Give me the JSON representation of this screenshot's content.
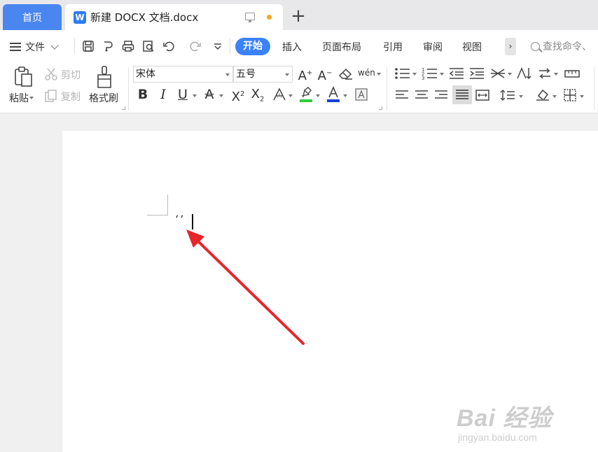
{
  "tabs": {
    "home": "首页",
    "doc_icon": "W",
    "doc_title": "新建 DOCX 文档.docx",
    "new_tab": "+"
  },
  "menu": {
    "file": "文件",
    "tabs": [
      "开始",
      "插入",
      "页面布局",
      "引用",
      "审阅",
      "视图"
    ],
    "more": "›",
    "search_placeholder": "查找命令、"
  },
  "ribbon": {
    "paste": "粘贴",
    "cut": "剪切",
    "copy": "复制",
    "format_painter": "格式刷",
    "font_name": "宋体",
    "font_size": "五号",
    "phonetic": "wén"
  },
  "document": {
    "typed_text": "‘’"
  },
  "watermark": {
    "brand": "Bai 经验",
    "url": "jingyan.baidu.com"
  },
  "colors": {
    "accent": "#3b82f6",
    "home_tab": "#4a86f0",
    "arrow": "#e8252a",
    "highlight": "#2ecc40",
    "font_color": "#1a3fd6"
  }
}
